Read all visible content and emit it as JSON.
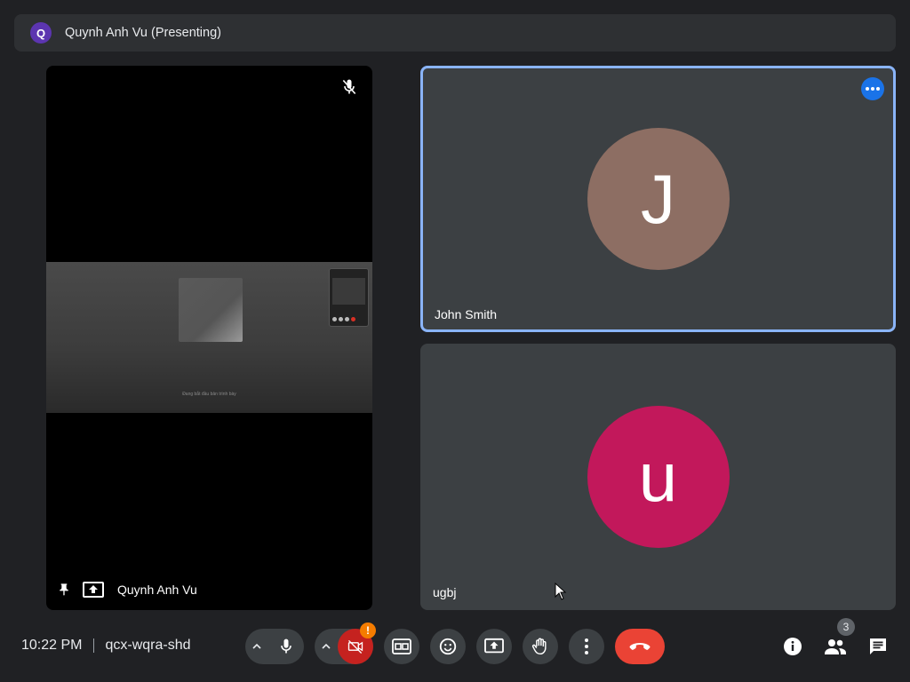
{
  "presenting_bar": {
    "avatar_letter": "Q",
    "text": "Quynh Anh Vu (Presenting)"
  },
  "presenter_tile": {
    "name": "Quynh Anh Vu",
    "shared_caption": "Đang bắt đầu bản trình bày",
    "icons": [
      "mic-off-icon",
      "pin-icon",
      "present-screen-icon"
    ]
  },
  "participants": [
    {
      "name": "John Smith",
      "avatar_letter": "J",
      "avatar_color": "#8d6e63",
      "active_speaker": true
    },
    {
      "name": "ugbj",
      "avatar_letter": "u",
      "avatar_color": "#c2185b",
      "active_speaker": false
    }
  ],
  "bottom_bar": {
    "time": "10:22 PM",
    "meeting_code": "qcx-wqra-shd",
    "camera_warning": "!",
    "people_count": "3",
    "controls": [
      "mic",
      "camera",
      "captions",
      "reactions",
      "present",
      "raise-hand",
      "more-options",
      "end-call"
    ],
    "right_icons": [
      "info-icon",
      "people-icon",
      "chat-icon"
    ]
  },
  "colors": {
    "background": "#202124",
    "tile": "#3c4043",
    "active_border": "#8ab4f8",
    "end_call": "#ea4335",
    "camera_off": "#c5221f",
    "warning": "#f57c00"
  }
}
